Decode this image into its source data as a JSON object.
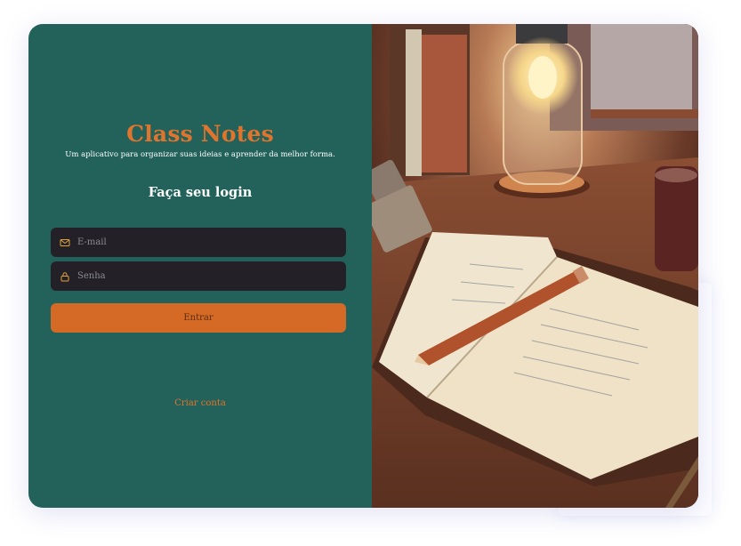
{
  "brand": {
    "title": "Class Notes",
    "subtitle": "Um aplicativo para organizar suas ideias e aprender da melhor forma."
  },
  "login": {
    "heading": "Faça seu login",
    "email_placeholder": "E-mail",
    "password_placeholder": "Senha",
    "submit_label": "Entrar",
    "create_account_label": "Criar conta"
  },
  "icons": {
    "email": "mail-icon",
    "password": "lock-icon"
  },
  "colors": {
    "panel": "#22625b",
    "accent": "#e0742c",
    "button": "#d46a25",
    "input_bg": "#232127"
  }
}
